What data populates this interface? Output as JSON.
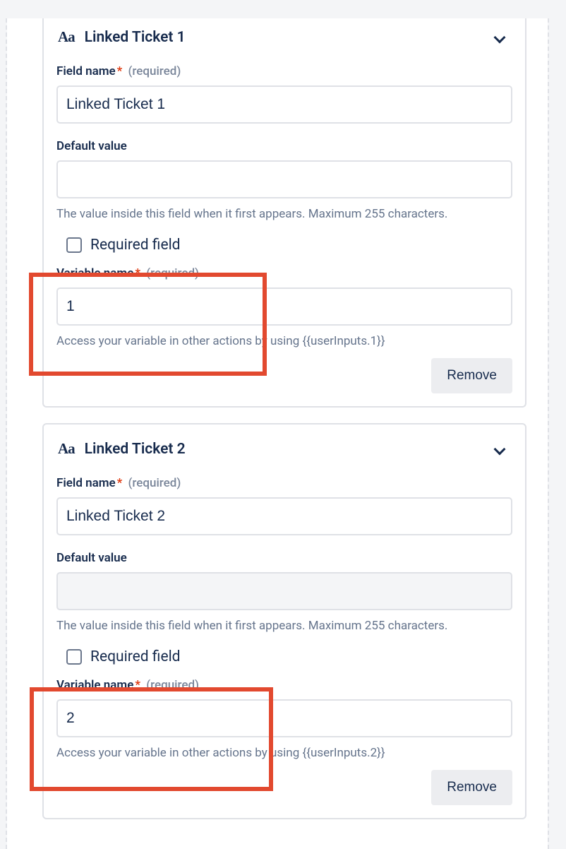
{
  "fields": [
    {
      "typeIcon": "Aa",
      "header": "Linked Ticket 1",
      "fieldName": {
        "label": "Field name",
        "required": "(required)",
        "value": "Linked Ticket 1"
      },
      "defaultValue": {
        "label": "Default value",
        "value": "",
        "help": "The value inside this field when it first appears. Maximum 255 characters."
      },
      "requiredField": {
        "label": "Required field",
        "checked": false
      },
      "variableName": {
        "label": "Variable name",
        "required": "(required)",
        "value": "1",
        "help": "Access your variable in other actions by using {{userInputs.1}}"
      },
      "removeLabel": "Remove"
    },
    {
      "typeIcon": "Aa",
      "header": "Linked Ticket 2",
      "fieldName": {
        "label": "Field name",
        "required": "(required)",
        "value": "Linked Ticket 2"
      },
      "defaultValue": {
        "label": "Default value",
        "value": "",
        "help": "The value inside this field when it first appears. Maximum 255 characters."
      },
      "requiredField": {
        "label": "Required field",
        "checked": false
      },
      "variableName": {
        "label": "Variable name",
        "required": "(required)",
        "value": "2",
        "help": "Access your variable in other actions by using {{userInputs.2}}"
      },
      "removeLabel": "Remove"
    }
  ],
  "asterisk": "*"
}
